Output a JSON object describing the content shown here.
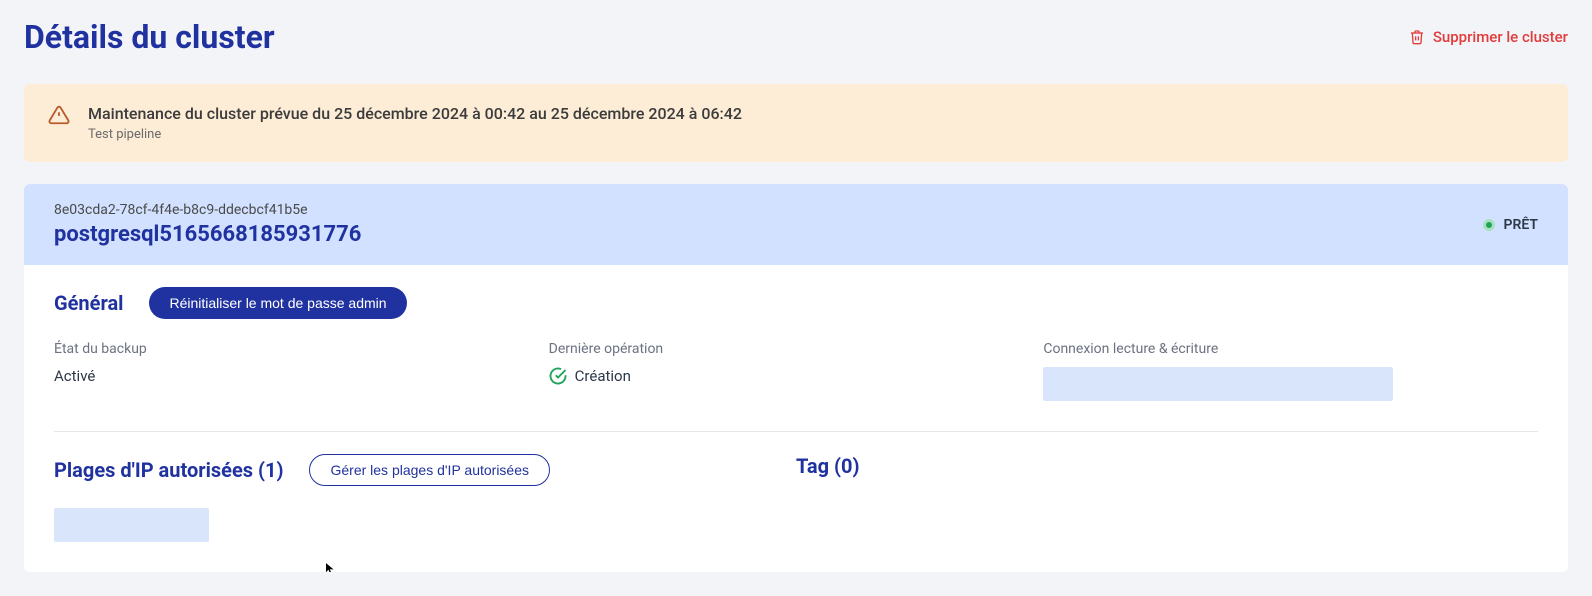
{
  "header": {
    "title": "Détails du cluster",
    "delete_label": "Supprimer le cluster"
  },
  "alert": {
    "title": "Maintenance du cluster prévue du 25 décembre 2024 à 00:42 au 25 décembre 2024 à 06:42",
    "subtitle": "Test pipeline"
  },
  "cluster": {
    "id": "8e03cda2-78cf-4f4e-b8c9-ddecbcf41b5e",
    "name": "postgresql5165668185931776",
    "status": "PRÊT"
  },
  "general": {
    "title": "Général",
    "reset_pw_label": "Réinitialiser le mot de passe admin",
    "backup_state_label": "État du backup",
    "backup_state_value": "Activé",
    "last_op_label": "Dernière opération",
    "last_op_value": "Création",
    "rw_conn_label": "Connexion lecture & écriture"
  },
  "ip_ranges": {
    "title": "Plages d'IP autorisées (1)",
    "manage_label": "Gérer les plages d'IP autorisées"
  },
  "tags": {
    "title": "Tag (0)"
  }
}
